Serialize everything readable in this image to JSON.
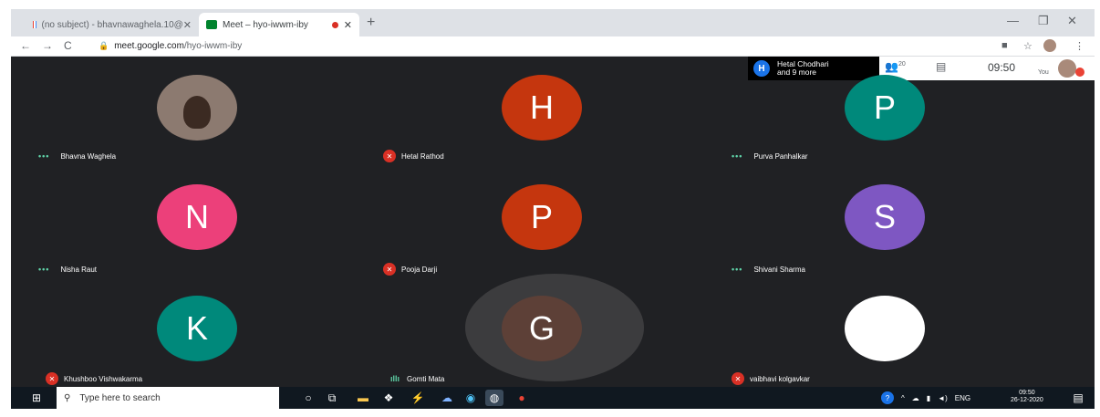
{
  "browser": {
    "tabs": [
      {
        "title": "(no subject) - bhavnawaghela.10@",
        "close": "✕"
      },
      {
        "title": "Meet – hyo-iwwm-iby",
        "close": "✕"
      }
    ],
    "new_tab": "+",
    "url_host": "meet.google.com",
    "url_path": "/hyo-iwwm-iby",
    "controls": {
      "minimize": "—",
      "restore": "❐",
      "close": "✕"
    }
  },
  "meet": {
    "presenter_initial": "H",
    "presenter_line1": "Hetal Chodhari",
    "presenter_line2": "and 9 more",
    "participant_count": "20",
    "time": "09:50",
    "you_label": "You"
  },
  "participants": [
    {
      "name": "Bhavna Waghela",
      "initial": "",
      "color": "#8c7a70",
      "status": "dots"
    },
    {
      "name": "Hetal Rathod",
      "initial": "H",
      "color": "#c5360e",
      "status": "muted"
    },
    {
      "name": "Purva Panhalkar",
      "initial": "P",
      "color": "#00897b",
      "status": "dots"
    },
    {
      "name": "Nisha Raut",
      "initial": "N",
      "color": "#ec407a",
      "status": "dots"
    },
    {
      "name": "Pooja Darji",
      "initial": "P",
      "color": "#c5360e",
      "status": "muted"
    },
    {
      "name": "Shivani Sharma",
      "initial": "S",
      "color": "#7e57c2",
      "status": "dots"
    },
    {
      "name": "Khushboo Vishwakarma",
      "initial": "K",
      "color": "#00897b",
      "status": "muted"
    },
    {
      "name": "Gomti Mata",
      "initial": "G",
      "color": "#5d4037",
      "status": "speaking"
    },
    {
      "name": "vaibhavi kolgavkar",
      "initial": "",
      "color": "#ffffff",
      "status": "muted"
    }
  ],
  "taskbar": {
    "search_placeholder": "Type here to search",
    "tray_lang": "ENG",
    "clock_time": "09:50",
    "clock_date": "26-12-2020"
  }
}
